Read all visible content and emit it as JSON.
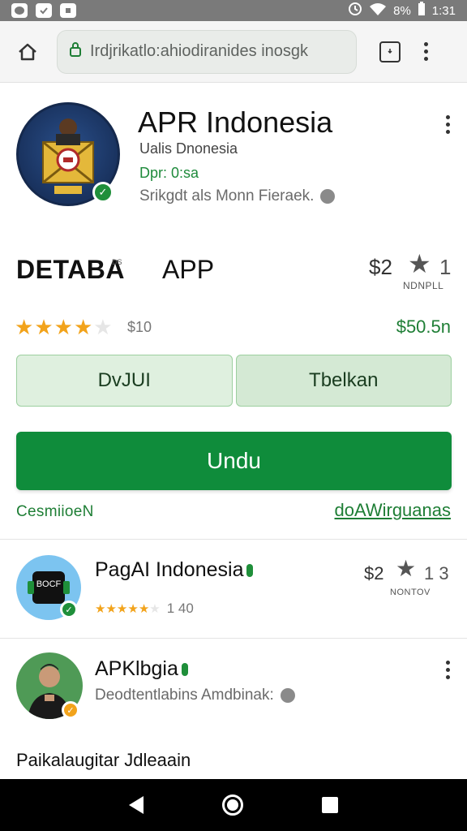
{
  "status_bar": {
    "battery": "8%",
    "time": "1:31"
  },
  "browser": {
    "url": "Irdjrikatlo:ahiodiranides inosgk",
    "tab_icon": "tabs-icon",
    "home_icon": "home-icon"
  },
  "app": {
    "title": "APR Indonesia",
    "developer": "Ualis Dnonesia",
    "version": "Dpr: 0:sa",
    "description": "Srikgdt als Monn Fieraek."
  },
  "details": {
    "label": "DETABA",
    "label_sup": "DS",
    "app_label": "APP",
    "price": "$2",
    "rating_value": "1",
    "rating_sub": "NDNPLL",
    "stars_filled": 4,
    "stars_total": 5,
    "rating_count": "$10",
    "price_right": "$50.5n"
  },
  "buttons": {
    "left_label": "DvJUI",
    "right_label": "Tbelkan",
    "primary_label": "Undu"
  },
  "links": {
    "left": "CesmiioeN",
    "right": "doAWirguanas"
  },
  "list": [
    {
      "title": "PagAI Indonesia",
      "icon_text": "BOCF",
      "stars_filled": 5,
      "stars_total": 6,
      "count": "1 40",
      "price": "$2",
      "rating_value": "1 3",
      "meta": "NONTOV"
    },
    {
      "title": "APKlbgia",
      "subtitle": "Deodtentlabins Amdbinak:"
    }
  ],
  "section_title": "Paikalaugitar Jdleaain",
  "colors": {
    "primary_green": "#0f8c3b",
    "star_orange": "#f2a31b",
    "status_gray": "#7a7a7a"
  }
}
